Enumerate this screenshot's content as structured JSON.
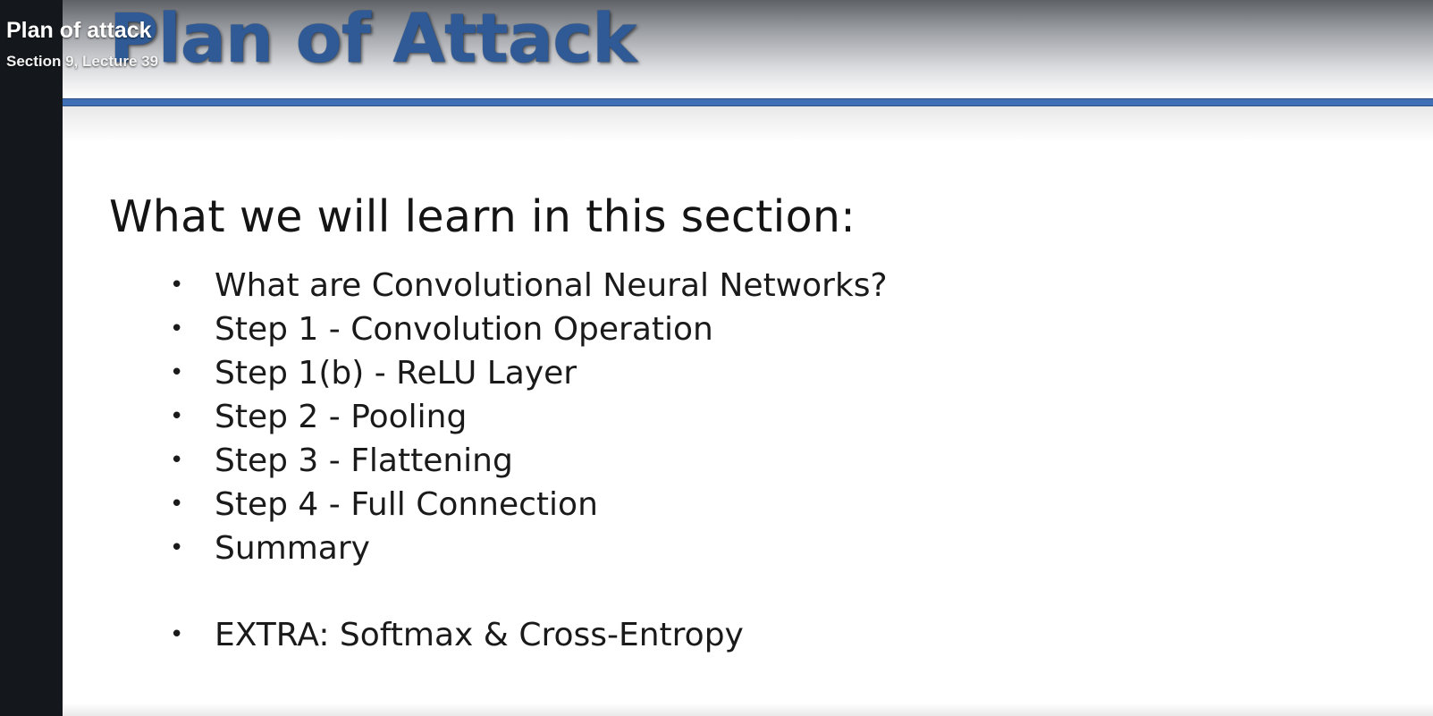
{
  "overlay": {
    "lecture_title": "Plan of attack",
    "lecture_subtitle": "Section 9, Lecture 39"
  },
  "slide": {
    "title": "Plan of Attack",
    "heading": "What we will learn in this section:",
    "bullet_symbol": "•",
    "items": [
      "What are Convolutional Neural Networks?",
      "Step 1 - Convolution Operation",
      "Step 1(b) - ReLU Layer",
      "Step 2 - Pooling",
      "Step 3 - Flattening",
      "Step 4 - Full Connection",
      "Summary",
      "EXTRA: Softmax & Cross-Entropy"
    ]
  },
  "colors": {
    "sidebar": "#14181c",
    "title_blue": "#2f5a96",
    "rule_blue": "#3f6fb5",
    "slide_bg": "#ffffff"
  }
}
